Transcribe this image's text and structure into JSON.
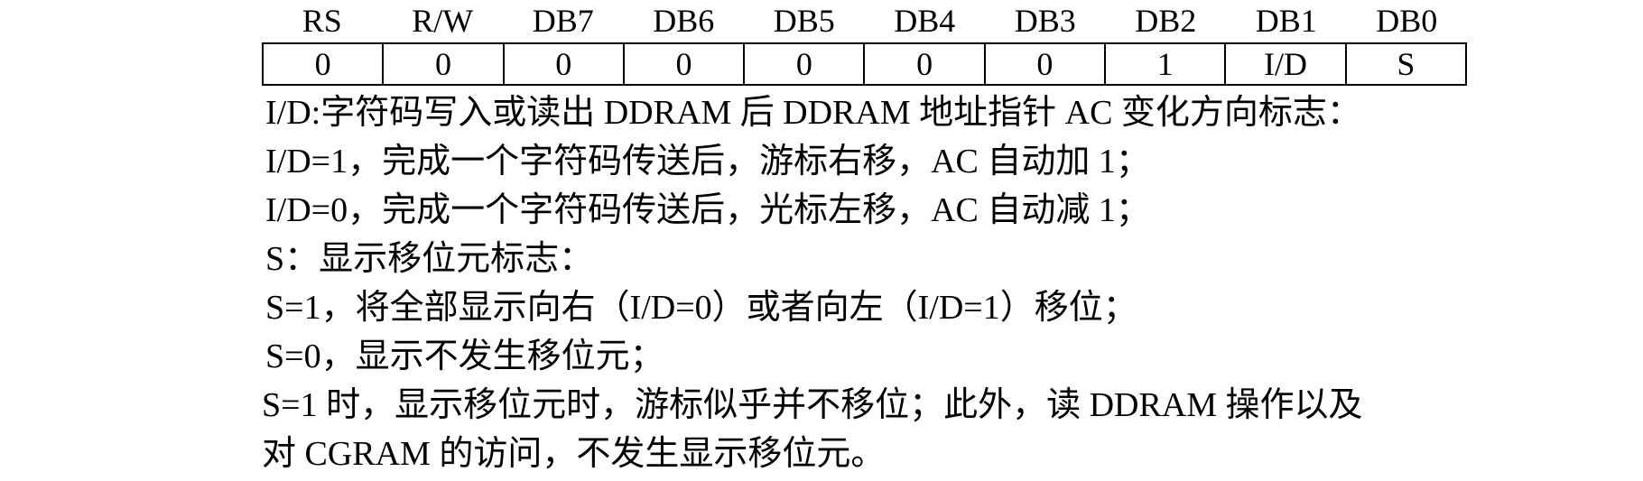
{
  "register": {
    "headers": [
      "RS",
      "R/W",
      "DB7",
      "DB6",
      "DB5",
      "DB4",
      "DB3",
      "DB2",
      "DB1",
      "DB0"
    ],
    "values": [
      "0",
      "0",
      "0",
      "0",
      "0",
      "0",
      "0",
      "1",
      "I/D",
      "S"
    ]
  },
  "lines": [
    "I/D:字符码写入或读出 DDRAM 后 DDRAM 地址指针 AC 变化方向标志：",
    "I/D=1，完成一个字符码传送后，游标右移，AC 自动加 1；",
    "I/D=0，完成一个字符码传送后，光标左移，AC 自动减 1；",
    "S：显示移位元标志：",
    "S=1，将全部显示向右（I/D=0）或者向左（I/D=1）移位；",
    "S=0，显示不发生移位元；",
    "S=1 时，显示移位元时，游标似乎并不移位；此外，读 DDRAM 操作以及",
    "对 CGRAM 的访问，不发生显示移位元。"
  ]
}
